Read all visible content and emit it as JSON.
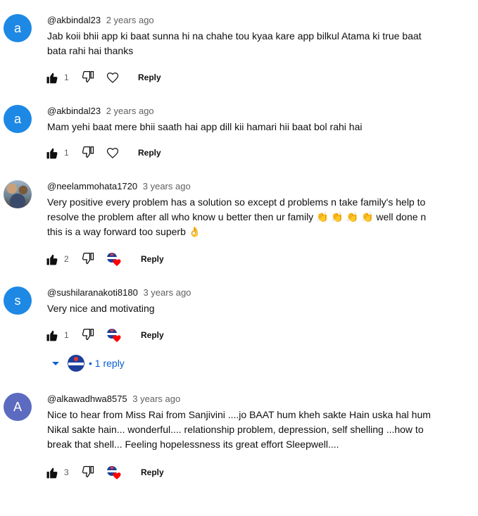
{
  "comments": [
    {
      "author": "@akbindal23",
      "time": "2 years ago",
      "avatar_letter": "a",
      "avatar_color": "#1e88e5",
      "text": "Jab koii bhii app ki baat sunna hi na chahe tou kyaa kare app bilkul Atama ki true baat\nbata rahi hai thanks",
      "likes": "1",
      "reply_label": "Reply",
      "creator_hearted": false
    },
    {
      "author": "@akbindal23",
      "time": "2 years ago",
      "avatar_letter": "a",
      "avatar_color": "#1e88e5",
      "text": "Mam yehi baat mere bhii saath hai app dill kii hamari hii baat bol rahi hai",
      "likes": "1",
      "reply_label": "Reply",
      "creator_hearted": false
    },
    {
      "author": "@neelammohata1720",
      "time": "3 years ago",
      "avatar_letter": "",
      "avatar_color": "#7a8a9a",
      "text": "Very positive every problem has a solution so except d problems n take family's help to\nresolve the problem after all who know u better then ur family 👏 👏 👏 👏 well done n\nthis is a way forward too superb 👌",
      "likes": "2",
      "reply_label": "Reply",
      "creator_hearted": true
    },
    {
      "author": "@sushilaranakoti8180",
      "time": "3 years ago",
      "avatar_letter": "s",
      "avatar_color": "#1e88e5",
      "text": "Very nice and motivating",
      "likes": "1",
      "reply_label": "Reply",
      "creator_hearted": true,
      "replies_label": "• 1 reply"
    },
    {
      "author": "@alkawadhwa8575",
      "time": "3 years ago",
      "avatar_letter": "A",
      "avatar_color": "#5c6bc0",
      "text": "Nice to hear from Miss Rai from Sanjivini ....jo BAAT hum kheh sakte Hain uska hal hum\nNikal sakte hain... wonderful.... relationship problem, depression, self shelling ...how to\nbreak that shell... Feeling hopelessness its great effort Sleepwell....",
      "likes": "3",
      "reply_label": "Reply",
      "creator_hearted": true
    }
  ],
  "colors": {
    "link_blue": "#065fd4",
    "heart_red": "#ff0000",
    "secondary_text": "#606060"
  }
}
